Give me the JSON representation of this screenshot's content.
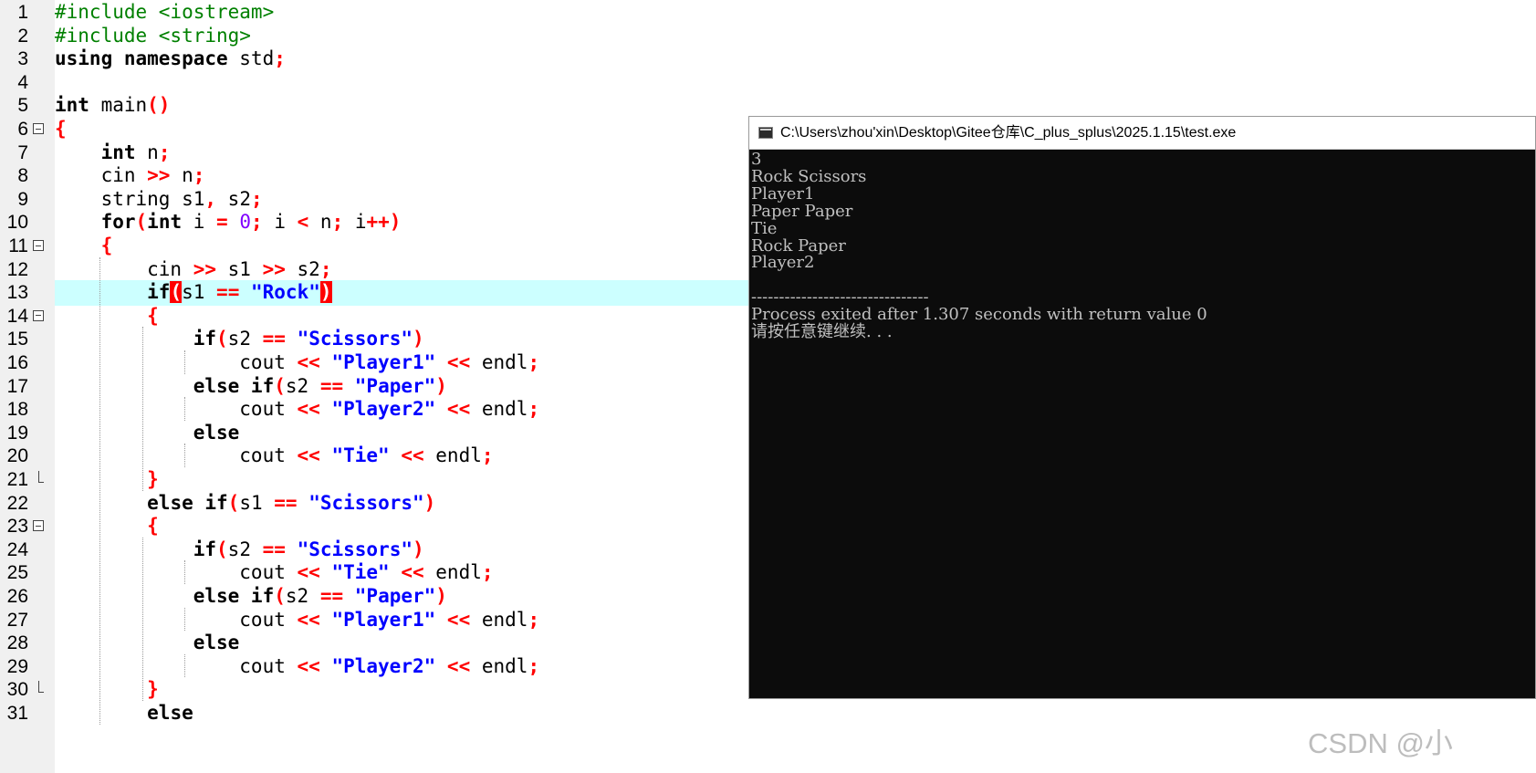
{
  "editor": {
    "lines": [
      {
        "n": "1",
        "segs": [
          [
            "pp",
            "#include <iostream>"
          ]
        ]
      },
      {
        "n": "2",
        "segs": [
          [
            "pp",
            "#include <string>"
          ]
        ]
      },
      {
        "n": "3",
        "segs": [
          [
            "kw",
            "using namespace"
          ],
          [
            "id",
            " std"
          ],
          [
            "op",
            ";"
          ]
        ]
      },
      {
        "n": "4",
        "segs": []
      },
      {
        "n": "5",
        "segs": [
          [
            "kw",
            "int"
          ],
          [
            "id",
            " main"
          ],
          [
            "op",
            "()"
          ]
        ]
      },
      {
        "n": "6",
        "fold": "open",
        "segs": [
          [
            "brace",
            "{"
          ]
        ]
      },
      {
        "n": "7",
        "segs": [
          [
            "id",
            "    "
          ],
          [
            "kw",
            "int"
          ],
          [
            "id",
            " n"
          ],
          [
            "op",
            ";"
          ]
        ]
      },
      {
        "n": "8",
        "segs": [
          [
            "id",
            "    cin "
          ],
          [
            "op",
            ">>"
          ],
          [
            "id",
            " n"
          ],
          [
            "op",
            ";"
          ]
        ]
      },
      {
        "n": "9",
        "segs": [
          [
            "id",
            "    string s1"
          ],
          [
            "op",
            ","
          ],
          [
            "id",
            " s2"
          ],
          [
            "op",
            ";"
          ]
        ]
      },
      {
        "n": "10",
        "segs": [
          [
            "id",
            "    "
          ],
          [
            "kw",
            "for"
          ],
          [
            "op",
            "("
          ],
          [
            "kw",
            "int"
          ],
          [
            "id",
            " i "
          ],
          [
            "op",
            "="
          ],
          [
            "id",
            " "
          ],
          [
            "num",
            "0"
          ],
          [
            "op",
            ";"
          ],
          [
            "id",
            " i "
          ],
          [
            "op",
            "<"
          ],
          [
            "id",
            " n"
          ],
          [
            "op",
            ";"
          ],
          [
            "id",
            " i"
          ],
          [
            "op",
            "++)"
          ]
        ]
      },
      {
        "n": "11",
        "fold": "open",
        "segs": [
          [
            "id",
            "    "
          ],
          [
            "brace",
            "{"
          ]
        ]
      },
      {
        "n": "12",
        "segs": [
          [
            "id",
            "        cin "
          ],
          [
            "op",
            ">>"
          ],
          [
            "id",
            " s1 "
          ],
          [
            "op",
            ">>"
          ],
          [
            "id",
            " s2"
          ],
          [
            "op",
            ";"
          ]
        ]
      },
      {
        "n": "13",
        "current": true,
        "segs": [
          [
            "id",
            "        "
          ],
          [
            "kw",
            "if"
          ],
          [
            "hl",
            "("
          ],
          [
            "id",
            "s1 "
          ],
          [
            "op",
            "=="
          ],
          [
            "id",
            " "
          ],
          [
            "str",
            "\"Rock\""
          ],
          [
            "hl",
            ")"
          ]
        ]
      },
      {
        "n": "14",
        "fold": "open",
        "segs": [
          [
            "id",
            "        "
          ],
          [
            "brace",
            "{"
          ]
        ]
      },
      {
        "n": "15",
        "segs": [
          [
            "id",
            "            "
          ],
          [
            "kw",
            "if"
          ],
          [
            "op",
            "("
          ],
          [
            "id",
            "s2 "
          ],
          [
            "op",
            "=="
          ],
          [
            "id",
            " "
          ],
          [
            "str",
            "\"Scissors\""
          ],
          [
            "op",
            ")"
          ]
        ]
      },
      {
        "n": "16",
        "segs": [
          [
            "id",
            "                cout "
          ],
          [
            "op",
            "<<"
          ],
          [
            "id",
            " "
          ],
          [
            "str",
            "\"Player1\""
          ],
          [
            "id",
            " "
          ],
          [
            "op",
            "<<"
          ],
          [
            "id",
            " endl"
          ],
          [
            "op",
            ";"
          ]
        ]
      },
      {
        "n": "17",
        "segs": [
          [
            "id",
            "            "
          ],
          [
            "kw",
            "else if"
          ],
          [
            "op",
            "("
          ],
          [
            "id",
            "s2 "
          ],
          [
            "op",
            "=="
          ],
          [
            "id",
            " "
          ],
          [
            "str",
            "\"Paper\""
          ],
          [
            "op",
            ")"
          ]
        ]
      },
      {
        "n": "18",
        "segs": [
          [
            "id",
            "                cout "
          ],
          [
            "op",
            "<<"
          ],
          [
            "id",
            " "
          ],
          [
            "str",
            "\"Player2\""
          ],
          [
            "id",
            " "
          ],
          [
            "op",
            "<<"
          ],
          [
            "id",
            " endl"
          ],
          [
            "op",
            ";"
          ]
        ]
      },
      {
        "n": "19",
        "segs": [
          [
            "id",
            "            "
          ],
          [
            "kw",
            "else"
          ]
        ]
      },
      {
        "n": "20",
        "segs": [
          [
            "id",
            "                cout "
          ],
          [
            "op",
            "<<"
          ],
          [
            "id",
            " "
          ],
          [
            "str",
            "\"Tie\""
          ],
          [
            "id",
            " "
          ],
          [
            "op",
            "<<"
          ],
          [
            "id",
            " endl"
          ],
          [
            "op",
            ";"
          ]
        ]
      },
      {
        "n": "21",
        "fold": "end",
        "segs": [
          [
            "id",
            "        "
          ],
          [
            "brace",
            "}"
          ]
        ]
      },
      {
        "n": "22",
        "segs": [
          [
            "id",
            "        "
          ],
          [
            "kw",
            "else if"
          ],
          [
            "op",
            "("
          ],
          [
            "id",
            "s1 "
          ],
          [
            "op",
            "=="
          ],
          [
            "id",
            " "
          ],
          [
            "str",
            "\"Scissors\""
          ],
          [
            "op",
            ")"
          ]
        ]
      },
      {
        "n": "23",
        "fold": "open",
        "segs": [
          [
            "id",
            "        "
          ],
          [
            "brace",
            "{"
          ]
        ]
      },
      {
        "n": "24",
        "segs": [
          [
            "id",
            "            "
          ],
          [
            "kw",
            "if"
          ],
          [
            "op",
            "("
          ],
          [
            "id",
            "s2 "
          ],
          [
            "op",
            "=="
          ],
          [
            "id",
            " "
          ],
          [
            "str",
            "\"Scissors\""
          ],
          [
            "op",
            ")"
          ]
        ]
      },
      {
        "n": "25",
        "segs": [
          [
            "id",
            "                cout "
          ],
          [
            "op",
            "<<"
          ],
          [
            "id",
            " "
          ],
          [
            "str",
            "\"Tie\""
          ],
          [
            "id",
            " "
          ],
          [
            "op",
            "<<"
          ],
          [
            "id",
            " endl"
          ],
          [
            "op",
            ";"
          ]
        ]
      },
      {
        "n": "26",
        "segs": [
          [
            "id",
            "            "
          ],
          [
            "kw",
            "else if"
          ],
          [
            "op",
            "("
          ],
          [
            "id",
            "s2 "
          ],
          [
            "op",
            "=="
          ],
          [
            "id",
            " "
          ],
          [
            "str",
            "\"Paper\""
          ],
          [
            "op",
            ")"
          ]
        ]
      },
      {
        "n": "27",
        "segs": [
          [
            "id",
            "                cout "
          ],
          [
            "op",
            "<<"
          ],
          [
            "id",
            " "
          ],
          [
            "str",
            "\"Player1\""
          ],
          [
            "id",
            " "
          ],
          [
            "op",
            "<<"
          ],
          [
            "id",
            " endl"
          ],
          [
            "op",
            ";"
          ]
        ]
      },
      {
        "n": "28",
        "segs": [
          [
            "id",
            "            "
          ],
          [
            "kw",
            "else"
          ]
        ]
      },
      {
        "n": "29",
        "segs": [
          [
            "id",
            "                cout "
          ],
          [
            "op",
            "<<"
          ],
          [
            "id",
            " "
          ],
          [
            "str",
            "\"Player2\""
          ],
          [
            "id",
            " "
          ],
          [
            "op",
            "<<"
          ],
          [
            "id",
            " endl"
          ],
          [
            "op",
            ";"
          ]
        ]
      },
      {
        "n": "30",
        "fold": "end",
        "segs": [
          [
            "id",
            "        "
          ],
          [
            "brace",
            "}"
          ]
        ]
      },
      {
        "n": "31",
        "segs": [
          [
            "id",
            "        "
          ],
          [
            "kw",
            "else"
          ]
        ]
      }
    ]
  },
  "console": {
    "title": "C:\\Users\\zhou'xin\\Desktop\\Gitee仓库\\C_plus_splus\\2025.1.15\\test.exe",
    "lines": [
      "3",
      "Rock Scissors",
      "Player1",
      "Paper Paper",
      "Tie",
      "Rock Paper",
      "Player2",
      "",
      "--------------------------------",
      "Process exited after 1.307 seconds with return value 0",
      "请按任意键继续. . ."
    ]
  },
  "watermark": "CSDN @小"
}
